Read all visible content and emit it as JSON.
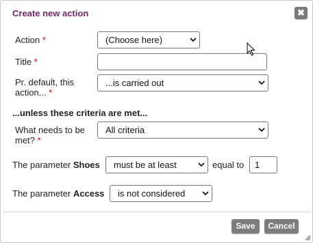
{
  "dialog": {
    "title": "Create new action",
    "close_icon": "close-icon"
  },
  "fields": {
    "action": {
      "label": "Action",
      "required": "*",
      "value": "(Choose here)"
    },
    "title": {
      "label": "Title",
      "required": "*",
      "value": ""
    },
    "default": {
      "label_line1": "Pr. default, this",
      "label_line2": "action...",
      "required": "*",
      "value": "...is carried out"
    }
  },
  "criteria": {
    "heading": "...unless these criteria are met...",
    "needs": {
      "label_line1": "What needs to be",
      "label_line2": "met?",
      "required": "*",
      "value": "All criteria"
    },
    "shoes": {
      "prefix": "The parameter ",
      "name": "Shoes",
      "operator": "must be at least",
      "equal_label": "equal to",
      "value": "1"
    },
    "access": {
      "prefix": "The parameter ",
      "name": "Access",
      "operator": "is not considered"
    }
  },
  "buttons": {
    "save": "Save",
    "cancel": "Cancel"
  }
}
